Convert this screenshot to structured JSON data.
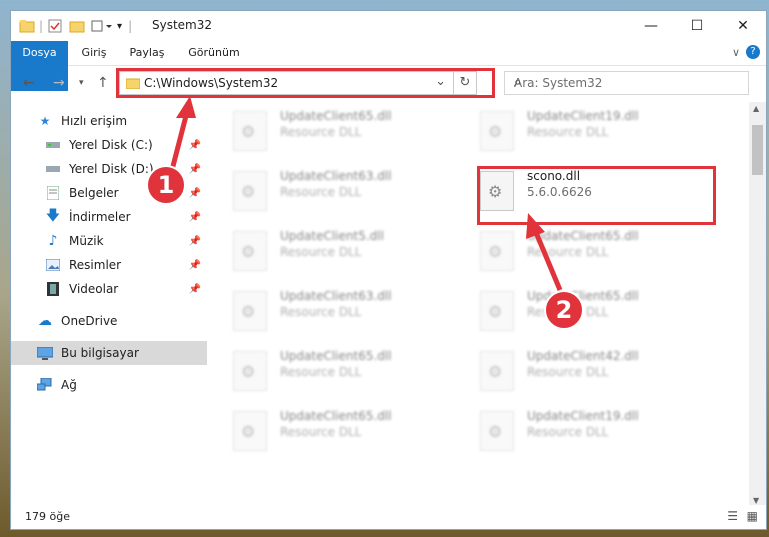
{
  "window": {
    "title": "System32",
    "controls": {
      "minimize": "—",
      "maximize": "☐",
      "close": "✕"
    }
  },
  "ribbon": {
    "tabs": [
      "Dosya",
      "Giriş",
      "Paylaş",
      "Görünüm"
    ]
  },
  "address": {
    "path": "C:\\Windows\\System32",
    "search_placeholder": "Ara: System32"
  },
  "sidebar": {
    "items": [
      {
        "label": "Hızlı erişim",
        "icon": "star-icon"
      },
      {
        "label": "Yerel Disk (C:)",
        "icon": "drive-icon"
      },
      {
        "label": "Yerel Disk (D:)",
        "icon": "drive-icon"
      },
      {
        "label": "Belgeler",
        "icon": "documents-icon"
      },
      {
        "label": "İndirmeler",
        "icon": "download-icon"
      },
      {
        "label": "Müzik",
        "icon": "music-icon"
      },
      {
        "label": "Resimler",
        "icon": "pictures-icon"
      },
      {
        "label": "Videolar",
        "icon": "videos-icon"
      },
      {
        "label": "OneDrive",
        "icon": "cloud-icon"
      },
      {
        "label": "Bu bilgisayar",
        "icon": "computer-icon"
      },
      {
        "label": "Ağ",
        "icon": "network-icon"
      }
    ]
  },
  "files": {
    "left": [
      {
        "name": "UpdateClient65.dll",
        "desc": "Resource DLL"
      },
      {
        "name": "UpdateClient63.dll",
        "desc": "Resource DLL"
      },
      {
        "name": "UpdateClient5.dll",
        "desc": "Resource DLL"
      },
      {
        "name": "UpdateClient63.dll",
        "desc": "Resource DLL"
      },
      {
        "name": "UpdateClient65.dll",
        "desc": "Resource DLL"
      },
      {
        "name": "UpdateClient65.dll",
        "desc": "Resource DLL"
      }
    ],
    "right": [
      {
        "name": "UpdateClient19.dll",
        "desc": "Resource DLL"
      },
      {
        "name": "scono.dll",
        "desc": "5.6.0.6626"
      },
      {
        "name": "UpdateClient65.dll",
        "desc": "Resource DLL"
      },
      {
        "name": "UpdateClient65.dll",
        "desc": "Resource DLL"
      },
      {
        "name": "UpdateClient42.dll",
        "desc": "Resource DLL"
      },
      {
        "name": "UpdateClient19.dll",
        "desc": "Resource DLL"
      }
    ]
  },
  "status": {
    "count": "179 öğe"
  },
  "annotations": {
    "badge1": "1",
    "badge2": "2",
    "color": "#e0333b"
  }
}
